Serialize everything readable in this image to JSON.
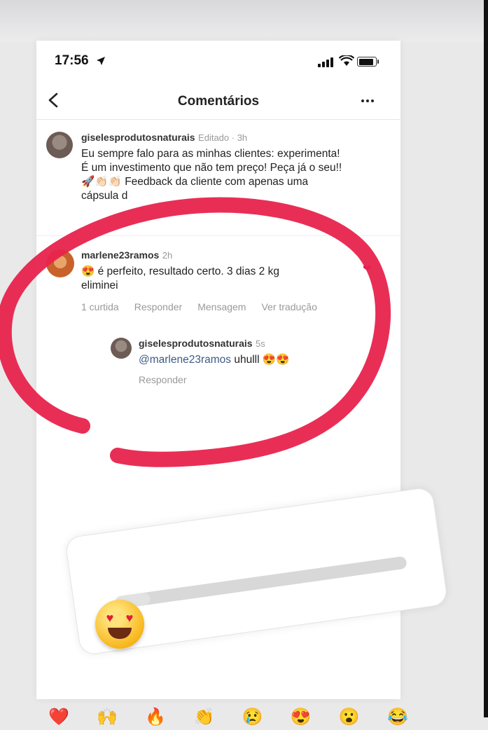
{
  "status_bar": {
    "time": "17:56"
  },
  "nav": {
    "title": "Comentários"
  },
  "caption": {
    "username": "giselesprodutosnaturais",
    "meta": "Editado · 3h",
    "line1": "Eu sempre falo para as minhas clientes: experimenta!",
    "line2": "É um investimento que não tem preço! Peça já o seu!!",
    "line3": "🚀👏🏻👏🏻 Feedback da cliente com apenas uma",
    "line4": "cápsula d"
  },
  "comment": {
    "username": "marlene23ramos",
    "meta": "2h",
    "text": "😍 é perfeito, resultado certo.  3 dias 2 kg",
    "text2": "eliminei",
    "likes": "1 curtida",
    "reply_label": "Responder",
    "message_label": "Mensagem",
    "translate_label": "Ver tradução"
  },
  "reply": {
    "username": "giselesprodutosnaturais",
    "meta": "5s",
    "mention": "@marlene23ramos",
    "text": " uhulll 😍😍",
    "reply_label": "Responder"
  },
  "slider_sticker": {
    "value": 0.12
  },
  "reactions": [
    "❤️",
    "🙌",
    "🔥",
    "👏",
    "😢",
    "😍",
    "😮",
    "😂"
  ],
  "colors": {
    "marker": "#e8234d",
    "mention": "#3d5a86"
  }
}
